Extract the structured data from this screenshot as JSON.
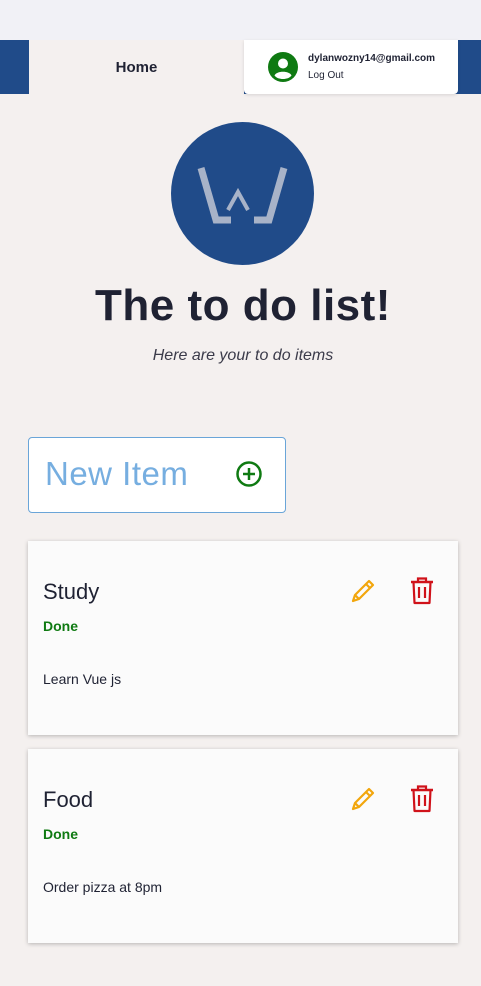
{
  "header": {
    "home_label": "Home",
    "user_email": "dylanwozny14@gmail.com",
    "logout_label": "Log Out"
  },
  "colors": {
    "brand_blue": "#204b89",
    "done_green": "#0f7a12",
    "edit_orange": "#f2a60c",
    "delete_red": "#d0121a",
    "new_item_blue": "#76aee0"
  },
  "icons": {
    "avatar": "user-avatar-icon",
    "logo": "w-logo-icon",
    "add": "plus-circle-icon",
    "edit": "pencil-icon",
    "delete": "trash-icon"
  },
  "hero": {
    "title": "The to do list!",
    "subtitle": "Here are your to do items"
  },
  "new_item": {
    "label": "New Item"
  },
  "todos": [
    {
      "title": "Study",
      "status": "Done",
      "description": "Learn Vue js"
    },
    {
      "title": "Food",
      "status": "Done",
      "description": "Order pizza at 8pm"
    }
  ]
}
